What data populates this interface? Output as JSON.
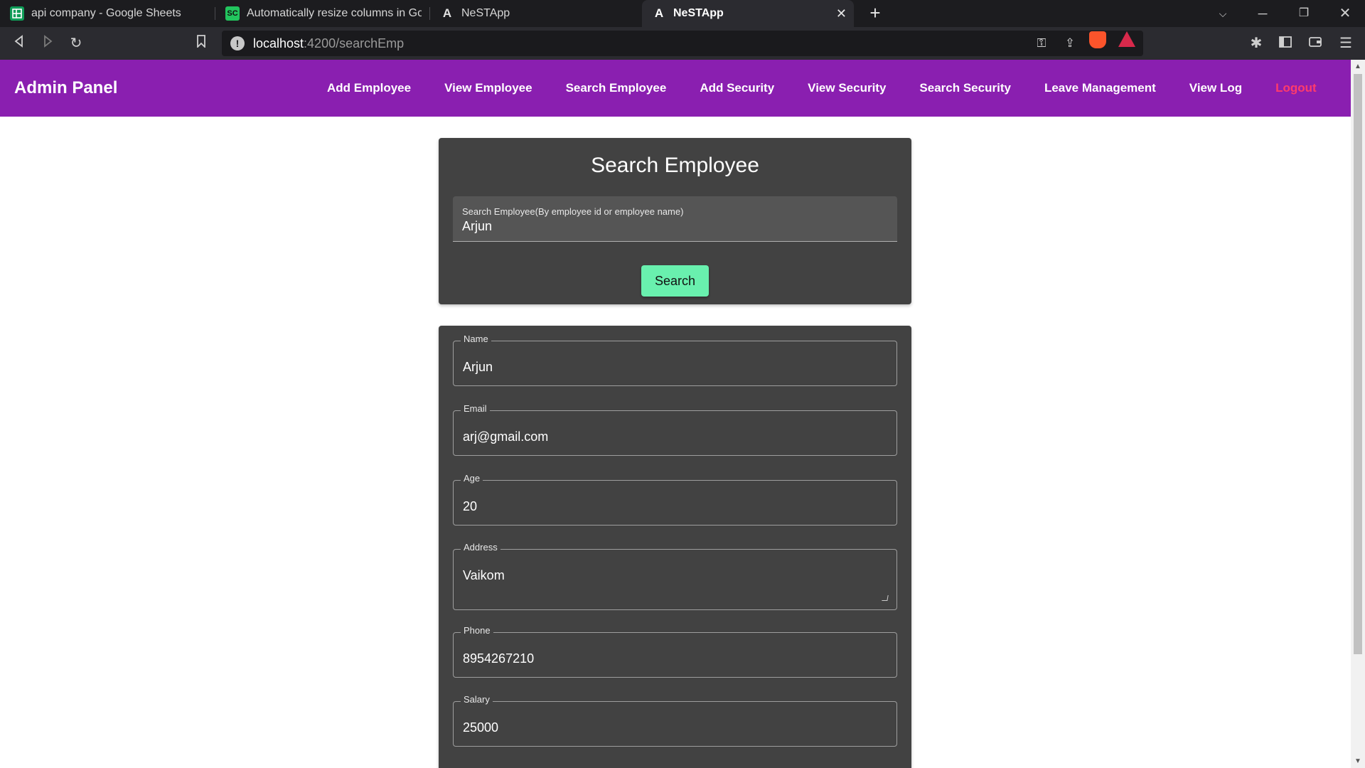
{
  "browser": {
    "tabs": [
      {
        "title": "api company - Google Sheets",
        "icon": "google-sheets-icon"
      },
      {
        "title": "Automatically resize columns in Googl",
        "icon": "site-icon"
      },
      {
        "title": "NeSTApp",
        "icon": "angular-icon"
      },
      {
        "title": "NeSTApp",
        "icon": "angular-icon",
        "active": true
      }
    ],
    "favicon_text": {
      "site": "SC",
      "angular": "A"
    },
    "url_host": "localhost",
    "url_path": ":4200/searchEmp",
    "colors": {
      "sheets_green": "#0f9d58",
      "site_green": "#22c55e",
      "brave_orange": "#fb542b",
      "rewards_red": "#d8294b"
    }
  },
  "navbar": {
    "brand": "Admin Panel",
    "links": [
      "Add Employee",
      "View Employee",
      "Search Employee",
      "Add Security",
      "View Security",
      "Search Security",
      "Leave Management",
      "View Log"
    ],
    "logout": "Logout",
    "colors": {
      "background": "#8a1fb0",
      "logout": "#ff3b6b"
    }
  },
  "search_card": {
    "title": "Search Employee",
    "field_label": "Search Employee(By employee id or employee name)",
    "field_value": "Arjun",
    "button_label": "Search",
    "button_color": "#69f0ae"
  },
  "result_card": {
    "fields": [
      {
        "label": "Name",
        "value": "Arjun"
      },
      {
        "label": "Email",
        "value": "arj@gmail.com"
      },
      {
        "label": "Age",
        "value": "20"
      },
      {
        "label": "Address",
        "value": "Vaikom"
      },
      {
        "label": "Phone",
        "value": "8954267210"
      },
      {
        "label": "Salary",
        "value": "25000"
      }
    ]
  }
}
